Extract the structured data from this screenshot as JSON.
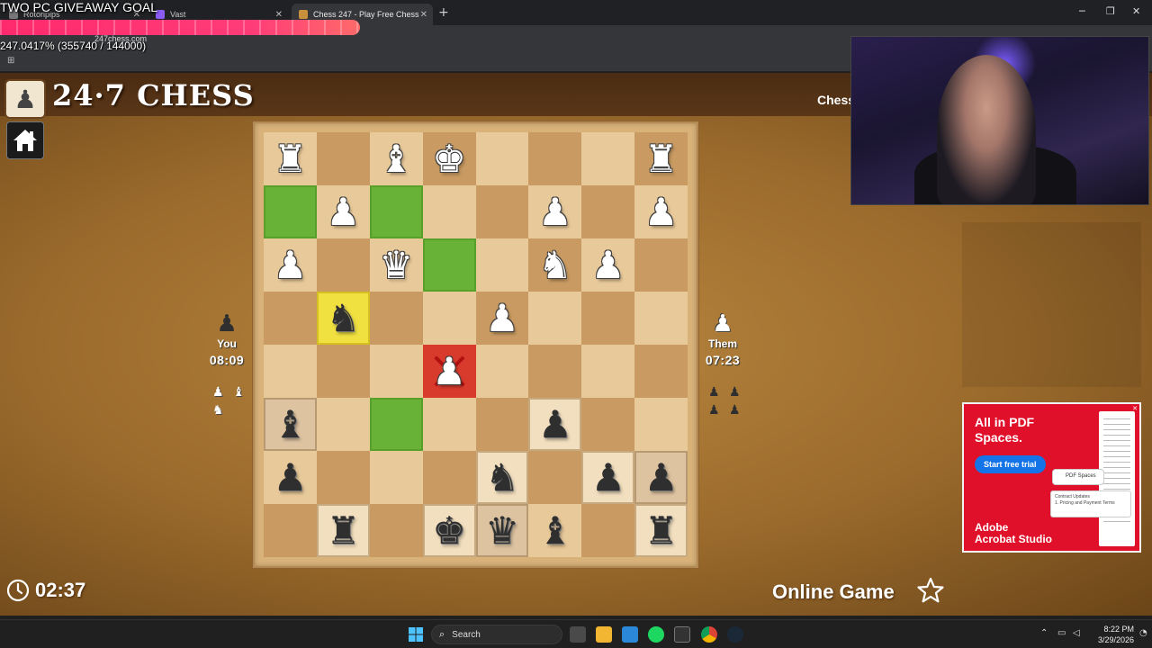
{
  "browser": {
    "tabs": [
      {
        "title": "Rotoripips"
      },
      {
        "title": "Vast"
      },
      {
        "title": "Chess 247 - Play Free Chess"
      }
    ],
    "url": "247chess.com"
  },
  "overlay": {
    "goal_title": "TWO PC GIVEAWAY GOAL",
    "goal_progress_fraction": 1.0,
    "goal_progress_text": "247.0417% (355740 / 144000)"
  },
  "game": {
    "logo_text": "24·7 CHESS",
    "header_link": "Chess",
    "you": {
      "name": "You",
      "clock": "08:09"
    },
    "them": {
      "name": "Them",
      "clock": "07:23"
    },
    "elapsed": "02:37",
    "mode": "Online Game",
    "board": [
      [
        "wR",
        "",
        "wB",
        "wK",
        "",
        "",
        "",
        "wR"
      ],
      [
        "",
        "wP",
        "",
        "",
        "",
        "wP",
        "",
        "wP"
      ],
      [
        "wP",
        "",
        "wQ",
        "",
        "",
        "wN",
        "wP",
        ""
      ],
      [
        "",
        "bN",
        "",
        "",
        "wP",
        "",
        "",
        ""
      ],
      [
        "",
        "",
        "",
        "wP",
        "",
        "",
        "",
        ""
      ],
      [
        "bB",
        "",
        "",
        "",
        "",
        "bP",
        "",
        ""
      ],
      [
        "bP",
        "",
        "",
        "",
        "bN",
        "",
        "bP",
        "bP"
      ],
      [
        "",
        "bR",
        "",
        "bK",
        "bQ",
        "bB",
        "",
        "bR"
      ]
    ],
    "pieces": {
      "wK": "♚",
      "wQ": "♛",
      "wR": "♜",
      "wB": "♝",
      "wN": "♞",
      "wP": "♟",
      "bK": "♚",
      "bQ": "♛",
      "bR": "♜",
      "bB": "♝",
      "bN": "♞",
      "bP": "♟"
    },
    "highlights": {
      "green": [
        "1-0",
        "1-2",
        "2-3",
        "5-2"
      ],
      "yellow": [
        "3-1"
      ],
      "red": [
        "4-3"
      ],
      "tan": [
        "5-0",
        "6-7",
        "7-4"
      ],
      "lighttan": [
        "5-5",
        "6-4",
        "6-6",
        "7-1",
        "7-3",
        "7-7"
      ]
    }
  },
  "ad": {
    "headline": "All in PDF Spaces.",
    "cta": "Start free trial",
    "brand_line1": "Adobe",
    "brand_line2": "Acrobat Studio",
    "chip": "PDF Spaces",
    "card_title": "Contract Updates",
    "card_line": "1. Pricing and Payment Terms"
  },
  "taskbar": {
    "search_placeholder": "Search",
    "time": "8:22 PM",
    "date": "3/29/2026"
  }
}
